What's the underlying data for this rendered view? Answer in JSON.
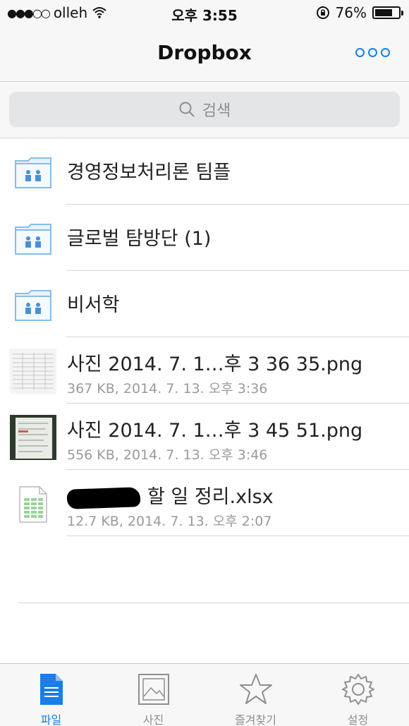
{
  "status_bar": {
    "signal_dots": "●●●○○",
    "carrier": "olleh",
    "time": "오후 3:55",
    "battery_percent": "76%",
    "battery_level": 0.76
  },
  "nav": {
    "title": "Dropbox",
    "more_icon": "more-ellipsis-icon"
  },
  "search": {
    "placeholder": "검색",
    "icon": "search-icon"
  },
  "files": [
    {
      "type": "shared-folder",
      "name": "경영정보처리론 팀플"
    },
    {
      "type": "shared-folder",
      "name": "글로벌 탐방단 (1)"
    },
    {
      "type": "shared-folder",
      "name": "비서학"
    },
    {
      "type": "image",
      "name": "사진 2014. 7. 1…후 3 36 35.png",
      "meta": "367 KB, 2014. 7. 13. 오후 3:36"
    },
    {
      "type": "image",
      "name": "사진 2014. 7. 1…후 3 45 51.png",
      "meta": "556 KB, 2014. 7. 13. 오후 3:46"
    },
    {
      "type": "spreadsheet",
      "name": "할 일 정리.xlsx",
      "meta": "12.7 KB, 2014. 7. 13. 오후 2:07"
    }
  ],
  "tabs": [
    {
      "label": "파일",
      "icon": "file-icon",
      "active": true
    },
    {
      "label": "사진",
      "icon": "photo-icon",
      "active": false
    },
    {
      "label": "즐겨찾기",
      "icon": "star-icon",
      "active": false
    },
    {
      "label": "설정",
      "icon": "gear-icon",
      "active": false
    }
  ],
  "colors": {
    "accent": "#1a7ee6",
    "folder": "#a9d0f0"
  }
}
